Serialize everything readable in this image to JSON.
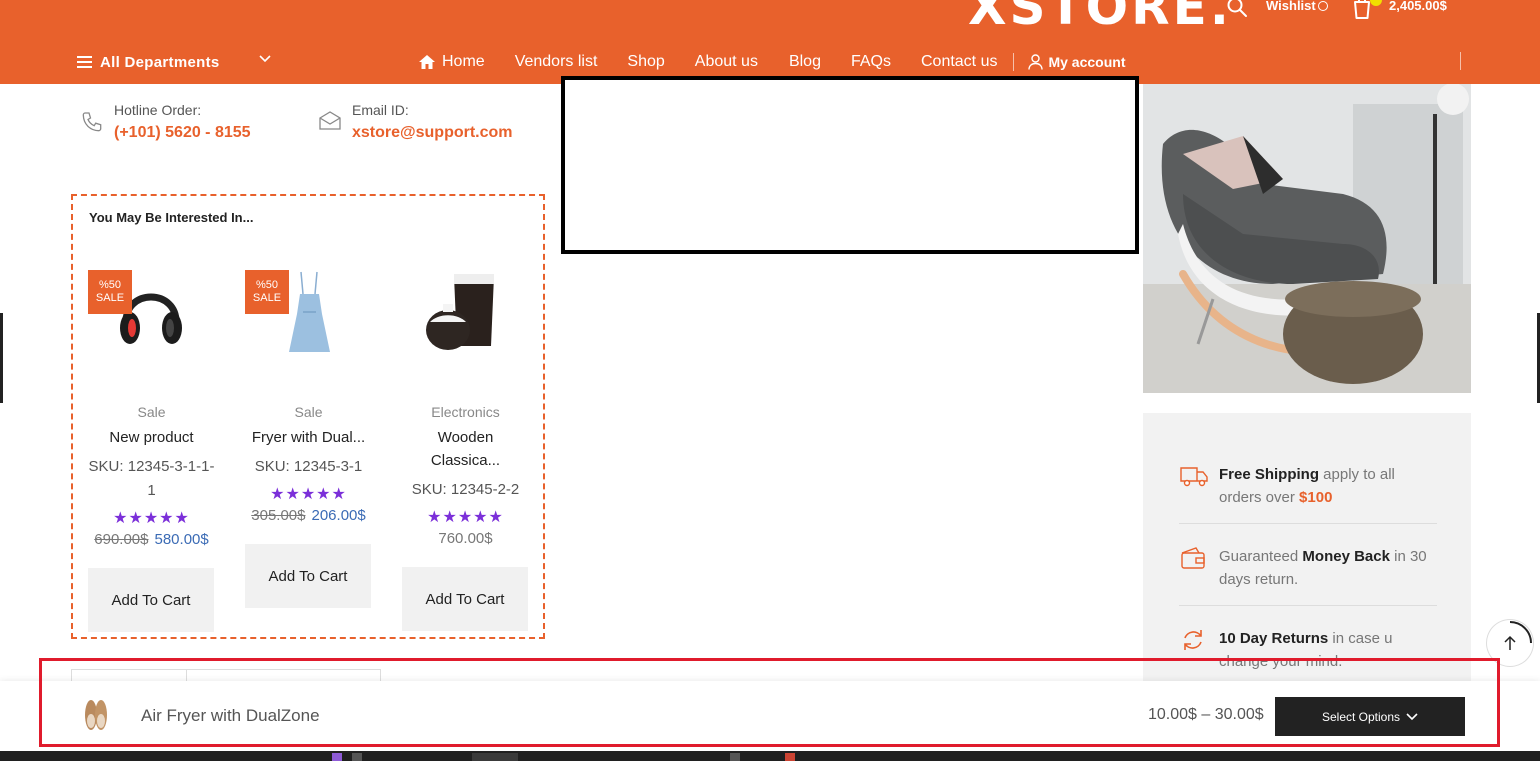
{
  "header": {
    "logo": "XSTORE.",
    "wishlist_label": "Wishlist",
    "cart_total": "2,405.00$",
    "departments_label": "All Departments",
    "nav": [
      "Home",
      "Vendors list",
      "Shop",
      "About us",
      "Blog",
      "FAQs",
      "Contact us"
    ],
    "account_label": "My account"
  },
  "contact": {
    "hotline_label": "Hotline Order:",
    "hotline_value": "(+101) 5620 - 8155",
    "email_label": "Email ID:",
    "email_value": "xstore@support.com"
  },
  "related": {
    "title": "You May Be Interested In...",
    "products": [
      {
        "badge_pct": "%50",
        "badge_label": "SALE",
        "category": "Sale",
        "name": "New product",
        "sku": "SKU: 12345-3-1-1-1",
        "rating": 5,
        "old_price": "690.00$",
        "price": "580.00$",
        "button": "Add To Cart"
      },
      {
        "badge_pct": "%50",
        "badge_label": "SALE",
        "category": "Sale",
        "name": "Fryer with Dual...",
        "sku": "SKU: 12345-3-1",
        "rating": 5,
        "old_price": "305.00$",
        "price": "206.00$",
        "button": "Add To Cart"
      },
      {
        "badge_pct": "",
        "badge_label": "",
        "category": "Electronics",
        "name": "Wooden Classica...",
        "sku": "SKU: 12345-2-2",
        "rating": 5,
        "old_price": "",
        "price": "760.00$",
        "button": "Add To Cart"
      }
    ]
  },
  "features": {
    "shipping_bold": "Free Shipping",
    "shipping_rest": " apply to all orders over ",
    "shipping_amount": "$100",
    "money_pre": "Guaranteed ",
    "money_bold": "Money Back",
    "money_rest": " in 30 days return.",
    "returns_bold": "10 Day Returns",
    "returns_rest": " in case u change your mind."
  },
  "sticky": {
    "product_name": "Air Fryer with DualZone",
    "price_range": "10.00$ – 30.00$",
    "button": "Select Options"
  },
  "colors": {
    "brand": "#E8612C",
    "rating_stars": "#7b2fd9",
    "highlight_frame": "#e01b2c"
  }
}
